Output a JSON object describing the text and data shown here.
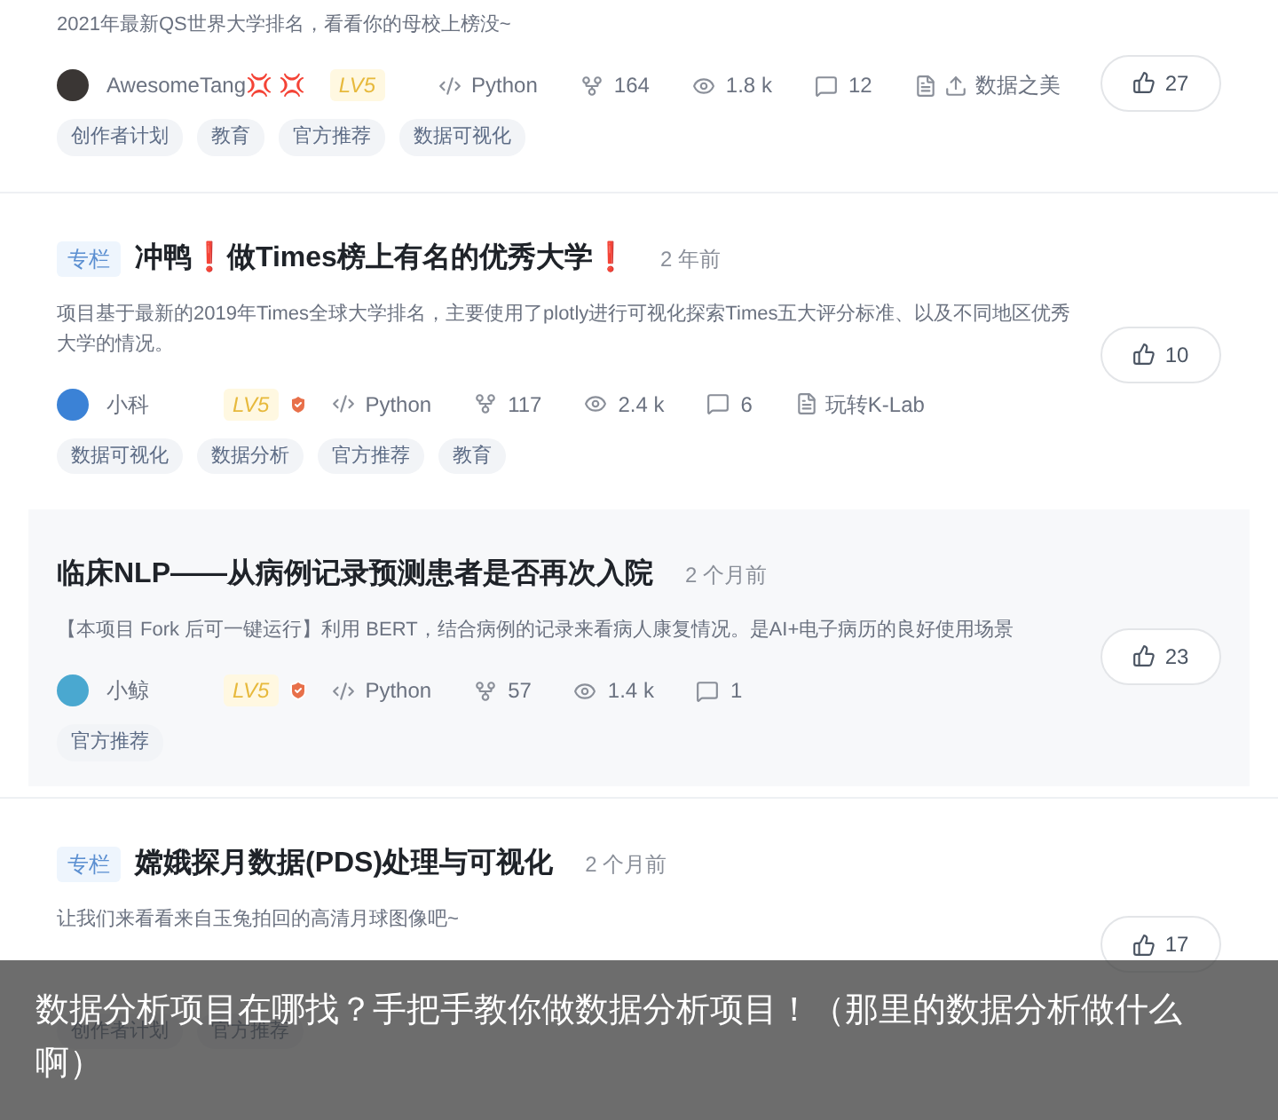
{
  "projects": [
    {
      "description": "2021年最新QS世界大学排名，看看你的母校上榜没~",
      "likes": "27",
      "hovered": false,
      "meta": {
        "avatar": {
          "color": "#3a3634"
        },
        "author": "AwesomeTang💢 💢",
        "level": "LV5",
        "verified": false,
        "language": "Python",
        "forks": "164",
        "views": "1.8 k",
        "comments": "12",
        "org": "数据之美",
        "org_upload": true
      },
      "tags": [
        "创作者计划",
        "教育",
        "官方推荐",
        "数据可视化"
      ]
    },
    {
      "column_tag": "专栏",
      "title": "冲鸭❗做Times榜上有名的优秀大学❗",
      "time": "2 年前",
      "description": "项目基于最新的2019年Times全球大学排名，主要使用了plotly进行可视化探索Times五大评分标准、以及不同地区优秀大学的情况。",
      "likes": "10",
      "hovered": false,
      "meta": {
        "avatar": {
          "color": "#3b82d6"
        },
        "author": "小科",
        "level": "LV5",
        "verified": true,
        "language": "Python",
        "forks": "117",
        "views": "2.4 k",
        "comments": "6",
        "org": "玩转K-Lab",
        "org_upload": false
      },
      "tags": [
        "数据可视化",
        "数据分析",
        "官方推荐",
        "教育"
      ]
    },
    {
      "title": "临床NLP——从病例记录预测患者是否再次入院",
      "time": "2 个月前",
      "description": "【本项目 Fork 后可一键运行】利用 BERT，结合病例的记录来看病人康复情况。是AI+电子病历的良好使用场景",
      "likes": "23",
      "hovered": true,
      "meta": {
        "avatar": {
          "color": "#4aa8d0"
        },
        "author": "小鲸",
        "level": "LV5",
        "verified": true,
        "language": "Python",
        "forks": "57",
        "views": "1.4 k",
        "comments": "1"
      },
      "tags": [
        "官方推荐"
      ]
    },
    {
      "column_tag": "专栏",
      "title": "嫦娥探月数据(PDS)处理与可视化",
      "time": "2 个月前",
      "description": "让我们来看看来自玉兔拍回的高清月球图像吧~",
      "likes": "17",
      "hovered": false,
      "tags": [
        "创作者计划",
        "官方推荐"
      ]
    }
  ],
  "caption": "数据分析项目在哪找？手把手教你做数据分析项目！（那里的数据分析做什么啊）"
}
